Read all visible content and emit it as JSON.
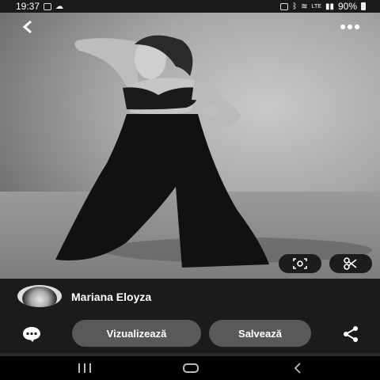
{
  "status_bar": {
    "time": "19:37",
    "battery": "90%",
    "left_icons": [
      "gallery-icon",
      "cloud-icon"
    ],
    "right_icons": [
      "alarm-icon",
      "bluetooth-icon",
      "wifi-icon",
      "volte-icon",
      "signal-icon",
      "battery-icon"
    ]
  },
  "header": {
    "back_icon": "chevron-left-icon",
    "more_icon": "ellipsis-icon"
  },
  "photo": {
    "actions": [
      "visual-search-icon",
      "scissors-icon"
    ]
  },
  "profile": {
    "name": "Mariana Eloyza"
  },
  "actions": {
    "view_label": "Vizualizează",
    "save_label": "Salvează",
    "comment_icon": "comment-icon",
    "share_icon": "share-icon"
  },
  "nav": {
    "items": [
      "recents-icon",
      "home-icon",
      "back-icon"
    ]
  }
}
